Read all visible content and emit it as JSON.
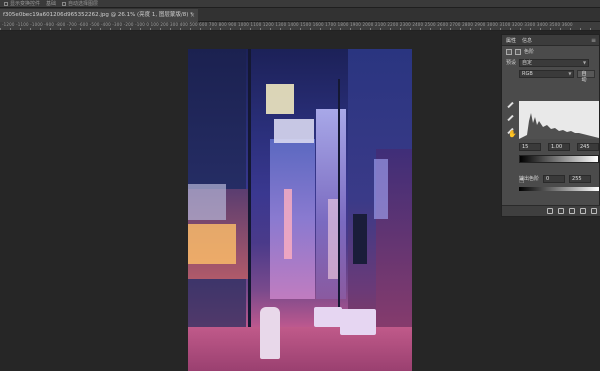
{
  "options_bar": {
    "items": [
      "显示变换控件",
      "基础",
      "自动选择图层"
    ]
  },
  "document": {
    "tab_title": "f305e0bec19a601206d965352262.jpg @ 26.1% (亮度 1, 图层蒙版/8) *",
    "close": "×"
  },
  "ruler": {
    "numbers": "-1200 -1100 -1000 -900 -800 -700 -600 -500 -400 -300 -200 -100 0 100 200 300 400 500 600 700 800 900 1000 1100 1200 1300 1400 1500 1600 1700 1800 1900 2000 2100 2200 2300 2400 2500 2600 2700 2800 2900 3000 3100 3200 3300 3400 3500 3600"
  },
  "properties_panel": {
    "tab_properties": "属性",
    "tab_info": "信息",
    "menu": "≡",
    "adjust_label": "色阶",
    "preset_label": "预设",
    "preset_value": "自定",
    "channel_value": "RGB",
    "auto_button": "自动",
    "input_black": "15",
    "input_gamma": "1.00",
    "input_white": "245",
    "output_label": "输出色阶",
    "output_black": "0",
    "output_white": "255",
    "secondary_tab_a": "信息",
    "secondary_tab_b": "调整"
  },
  "colors": {
    "panel_bg": "#4b4b4b",
    "app_bg": "#282828"
  }
}
